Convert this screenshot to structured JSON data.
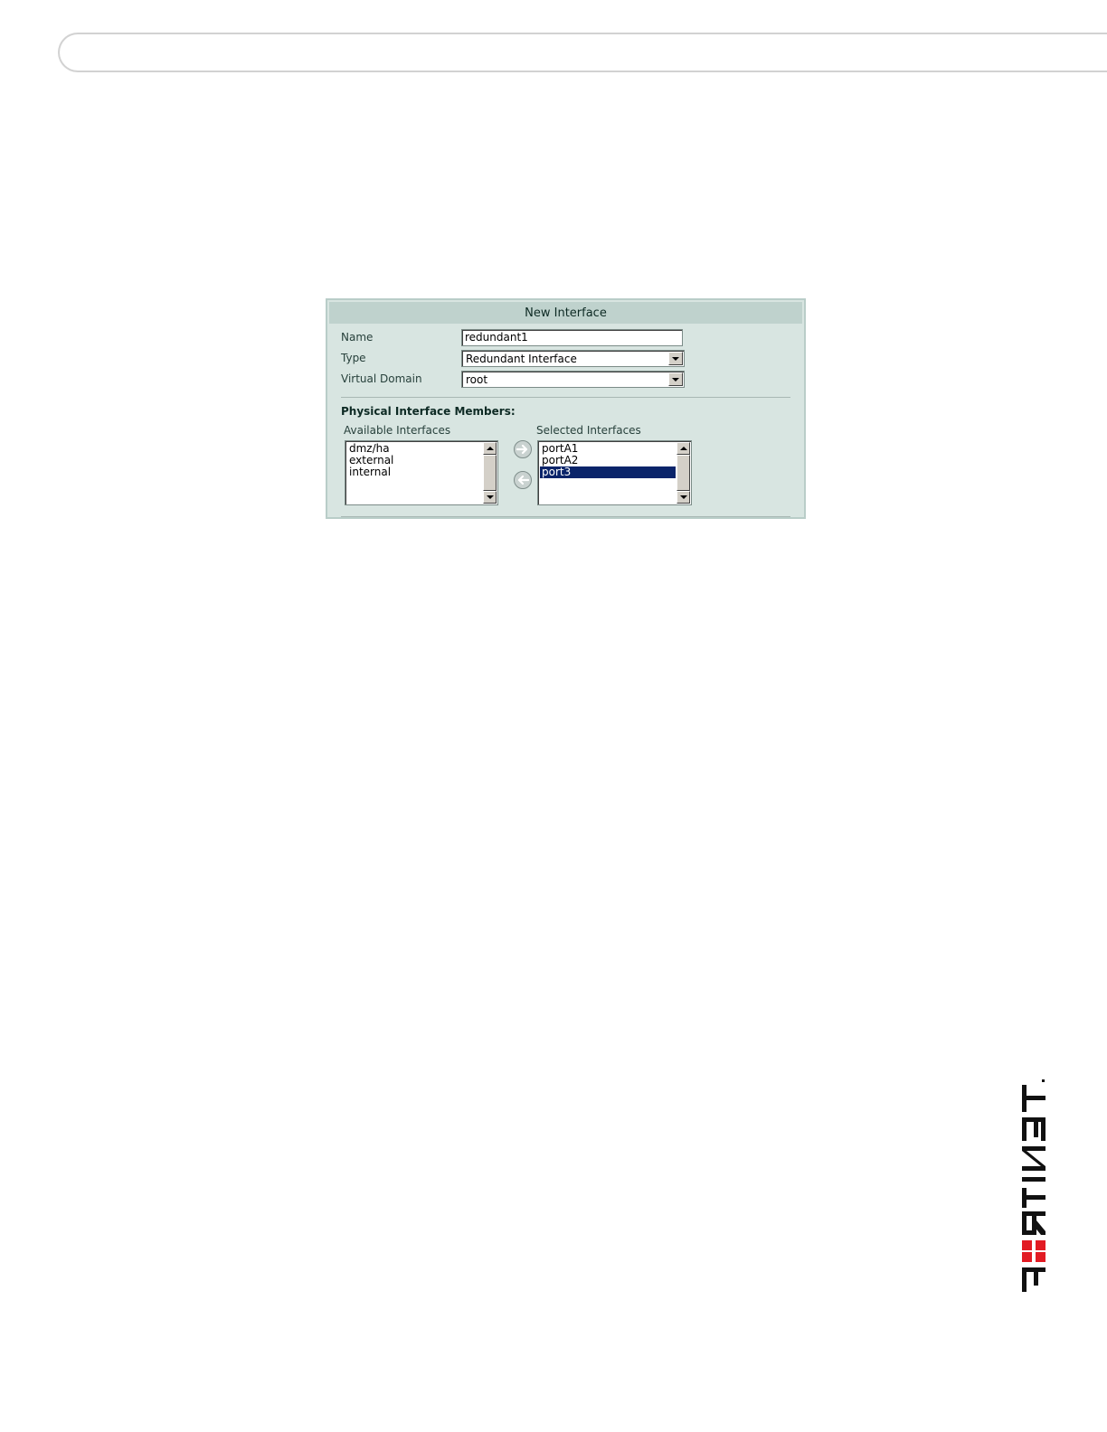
{
  "dialog": {
    "title": "New Interface",
    "name_label": "Name",
    "name_value": "redundant1",
    "type_label": "Type",
    "type_value": "Redundant Interface",
    "vdom_label": "Virtual Domain",
    "vdom_value": "root",
    "section_title": "Physical Interface Members:",
    "available_label": "Available Interfaces",
    "selected_label": "Selected Interfaces",
    "available_items": [
      "dmz/ha",
      "external",
      "internal"
    ],
    "selected_items": [
      "portA1",
      "portA2",
      "port3"
    ],
    "selected_highlight": "port3"
  },
  "icons": {
    "move_right": "arrow-right-icon",
    "move_left": "arrow-left-icon"
  },
  "colors": {
    "panel_bg": "#d8e5e1",
    "title_bar": "#bfd2cd",
    "selection": "#0a246a",
    "brand_red": "#e21b23"
  },
  "brand": {
    "logo_text": "FORTINET"
  }
}
